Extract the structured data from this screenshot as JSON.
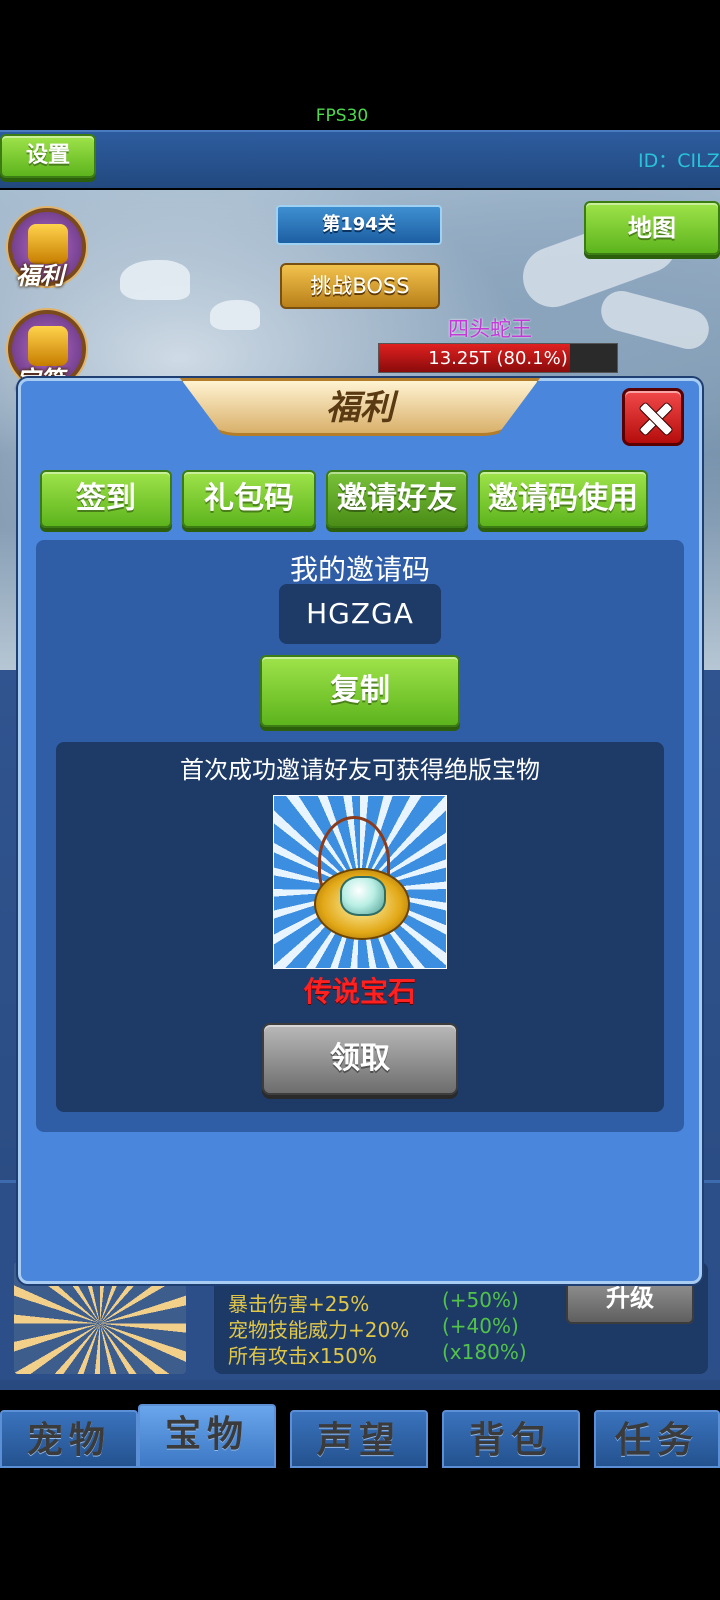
{
  "hud": {
    "fps": "FPS30",
    "settings_label": "设置",
    "player_id": "ID：CILZ"
  },
  "scene": {
    "stage_label": "第194关",
    "challenge_boss_label": "挑战BOSS",
    "map_label": "地图",
    "boss_name": "四头蛇王",
    "boss_hp_text": "13.25T (80.1%)",
    "boss_hp_percent": 80.1,
    "side_icons": [
      {
        "label": "福利",
        "icon": "gift-bag-icon"
      },
      {
        "label": "宝箱",
        "icon": "treasure-chest-icon"
      }
    ]
  },
  "modal": {
    "title": "福利",
    "tabs": [
      {
        "label": "签到"
      },
      {
        "label": "礼包码"
      },
      {
        "label": "邀请好友",
        "selected": true
      },
      {
        "label": "邀请码使用"
      }
    ],
    "invite_code_label": "我的邀请码",
    "invite_code": "HGZGA",
    "copy_label": "复制",
    "reward_desc": "首次成功邀请好友可获得绝版宝物",
    "reward_name": "传说宝石",
    "claim_label": "领取"
  },
  "treasure_card": {
    "stats": [
      {
        "text": "暴击伤害+25%",
        "bonus": "(+50%)"
      },
      {
        "text": "宠物技能威力+20%",
        "bonus": "(+40%)"
      },
      {
        "text": "所有攻击x150%",
        "bonus": "(x180%)"
      }
    ],
    "upgrade_label": "升级"
  },
  "bottom_tabs": [
    {
      "label": "宠物"
    },
    {
      "label": "宝物",
      "active": true
    },
    {
      "label": "声望"
    },
    {
      "label": "背包"
    },
    {
      "label": "任务"
    }
  ],
  "colors": {
    "modal_bg": "#4a86dc",
    "green_button": "#6bc12a",
    "reward_name": "#ff2020",
    "stat_text": "#e0c648",
    "stat_bonus": "#52c24a",
    "boss_name": "#c438d8"
  }
}
